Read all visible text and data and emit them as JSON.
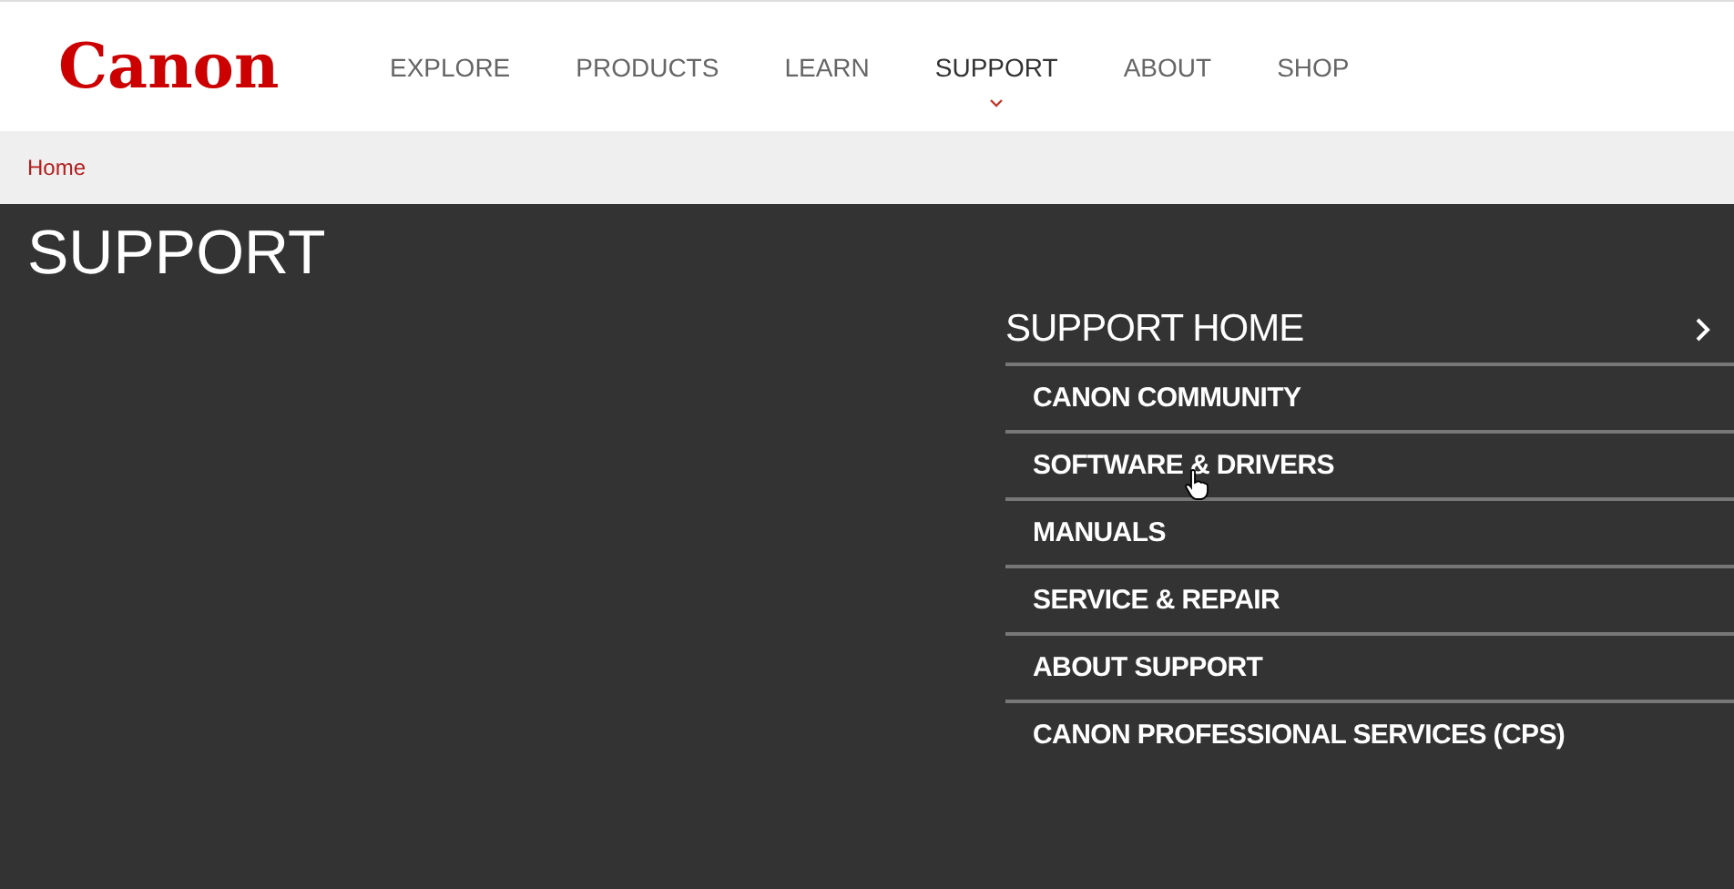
{
  "header": {
    "logo": "Canon",
    "nav": [
      {
        "label": "EXPLORE",
        "selected": false
      },
      {
        "label": "PRODUCTS",
        "selected": false
      },
      {
        "label": "LEARN",
        "selected": false
      },
      {
        "label": "SUPPORT",
        "selected": true
      },
      {
        "label": "ABOUT",
        "selected": false
      },
      {
        "label": "SHOP",
        "selected": false
      }
    ]
  },
  "breadcrumb": [
    "Home"
  ],
  "page_title": "SUPPORT",
  "support_menu": {
    "title": "SUPPORT HOME",
    "items": [
      {
        "label": "CANON COMMUNITY",
        "hovered": false
      },
      {
        "label": "SOFTWARE & DRIVERS",
        "hovered": true
      },
      {
        "label": "MANUALS",
        "hovered": false
      },
      {
        "label": "SERVICE & REPAIR",
        "hovered": false
      },
      {
        "label": "ABOUT SUPPORT",
        "hovered": false
      },
      {
        "label": "CANON PROFESSIONAL SERVICES (CPS)",
        "hovered": false
      }
    ]
  }
}
